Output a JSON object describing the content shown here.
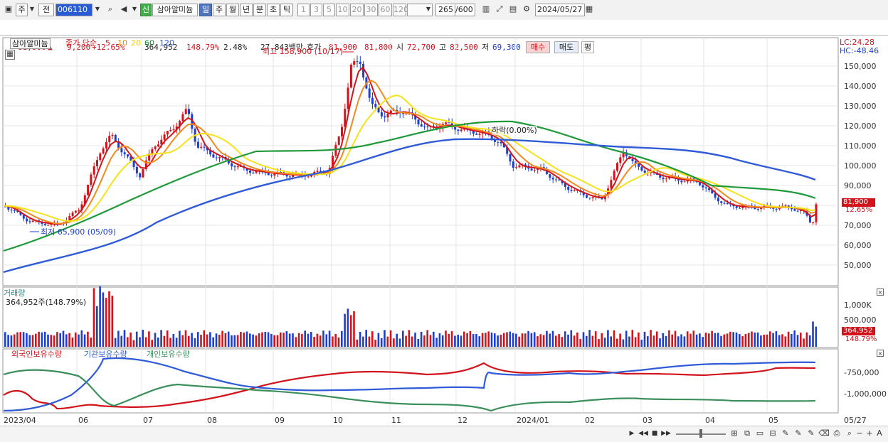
{
  "toolbar": {
    "market": "주",
    "market_opt": "전",
    "code": "006110",
    "badge": "신",
    "stock_name": "삼아알미늄",
    "periods": [
      "일",
      "주",
      "월",
      "년",
      "분",
      "초",
      "틱"
    ],
    "period_active": "일",
    "intervals": [
      "1",
      "3",
      "5",
      "10",
      "20",
      "30",
      "60",
      "120"
    ],
    "count": "265",
    "count_max": "/600",
    "date": "2024/05/27"
  },
  "quote": {
    "price": "81,900",
    "arrow": "▲",
    "change": "9,200",
    "change_pct": "+12.65%",
    "volume": "364,952",
    "volume_ratio": "148.79%",
    "turnover": "2.48%",
    "amount": "27,843백만",
    "label_hoga": "호가",
    "ask": "81,900",
    "bid": "81,800",
    "label_open": "시",
    "open": "72,700",
    "label_high": "고",
    "high": "82,500",
    "label_low": "저",
    "low": "69,300",
    "buy": "매수",
    "sell": "매도",
    "avg": "평"
  },
  "chart": {
    "name": "삼아알미늄",
    "ma_title": "종가 단순",
    "ma_periods": [
      "5",
      "10",
      "20",
      "60",
      "120"
    ],
    "ma_colors": [
      "#d3131b",
      "#f08a1e",
      "#f5e21a",
      "#1f9a3a",
      "#2f5bd8"
    ],
    "lc": "LC:24.28",
    "hc": "HC:-48.46",
    "high_note": "최고 158,900 (10/17)",
    "low_note": "최저 65,900 (05/09)",
    "drop_note": "하락(0.00%)",
    "price_tag": "81,900",
    "price_tag_pct": "12.65%",
    "y_ticks": [
      "150,000",
      "140,000",
      "130,000",
      "120,000",
      "110,000",
      "100,000",
      "90,000",
      "80,000",
      "70,000",
      "60,000",
      "50,000"
    ],
    "up_color": "#d3131b",
    "down_color": "#1c3fcf"
  },
  "volume": {
    "title": "거래량",
    "value": "364,952주(148.79%)",
    "y_tick": "1,000K",
    "y_tick2": "500,000",
    "tag": "364,952",
    "tag_pct": "148.79%"
  },
  "holdings": {
    "foreign": "외국인보유수량",
    "inst": "기관보유수량",
    "indiv": "개인보유수량",
    "y_ticks": [
      "-750,000",
      "-1,000,000"
    ],
    "colors": {
      "foreign": "#d3131b",
      "inst": "#2f5bd8",
      "indiv": "#3a8f5a"
    }
  },
  "x_axis": [
    "2023/04",
    "06",
    "07",
    "08",
    "09",
    "10",
    "11",
    "12",
    "2024/01",
    "02",
    "03",
    "04",
    "05",
    "05/27"
  ]
}
